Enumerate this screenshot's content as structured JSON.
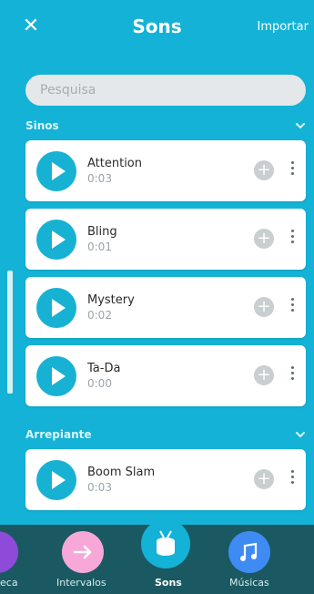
{
  "header": {
    "close_icon": "close-icon",
    "title": "Sons",
    "import_label": "Importar"
  },
  "search": {
    "placeholder": "Pesquisa"
  },
  "sections": [
    {
      "title": "Sinos",
      "items": [
        {
          "name": "Attention",
          "duration": "0:03"
        },
        {
          "name": "Bling",
          "duration": "0:01"
        },
        {
          "name": "Mystery",
          "duration": "0:02"
        },
        {
          "name": "Ta-Da",
          "duration": "0:00"
        }
      ]
    },
    {
      "title": "Arrepiante",
      "items": [
        {
          "name": "Boom Slam",
          "duration": "0:03"
        }
      ]
    }
  ],
  "tabs": [
    {
      "label": "eca",
      "color": "#8e4bd9",
      "icon": "library-icon"
    },
    {
      "label": "Intervalos",
      "color": "#f7a8d8",
      "icon": "arrow-right-icon"
    },
    {
      "label": "Sons",
      "color": "#14b2d6",
      "icon": "drum-icon"
    },
    {
      "label": "Músicas",
      "color": "#3f8bf4",
      "icon": "music-note-icon"
    }
  ],
  "colors": {
    "primary": "#14b2d6",
    "tab_bar": "#1a5961"
  }
}
